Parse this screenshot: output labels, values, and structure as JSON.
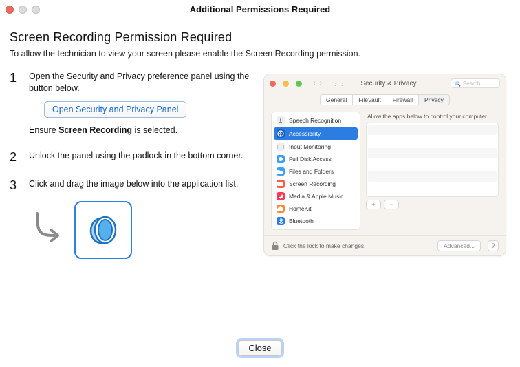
{
  "window": {
    "title": "Additional Permissions Required"
  },
  "heading": "Screen Recording Permission Required",
  "subtitle": "To allow the technician to view your screen please enable the Screen Recording permission.",
  "steps": {
    "s1": {
      "num": "1",
      "text": "Open the Security and Privacy preference panel using the button below.",
      "button": "Open Security and Privacy Panel",
      "ensure_pre": "Ensure ",
      "ensure_bold": "Screen Recording",
      "ensure_post": " is selected."
    },
    "s2": {
      "num": "2",
      "text": "Unlock the panel using the padlock in the bottom corner."
    },
    "s3": {
      "num": "3",
      "text": "Click and drag the image below into the application list."
    }
  },
  "shot": {
    "title": "Security & Privacy",
    "search": "Search",
    "tabs": {
      "t1": "General",
      "t2": "FileVault",
      "t3": "Firewall",
      "t4": "Privacy"
    },
    "panel_head": "Allow the apps below to control your computer.",
    "sidebar": {
      "i0": "Speech Recognition",
      "i1": "Accessibility",
      "i2": "Input Monitoring",
      "i3": "Full Disk Access",
      "i4": "Files and Folders",
      "i5": "Screen Recording",
      "i6": "Media & Apple Music",
      "i7": "HomeKit",
      "i8": "Bluetooth"
    },
    "plus": "+",
    "minus": "−",
    "footer_text": "Click the lock to make changes.",
    "advanced": "Advanced...",
    "help": "?"
  },
  "footer": {
    "close": "Close"
  }
}
